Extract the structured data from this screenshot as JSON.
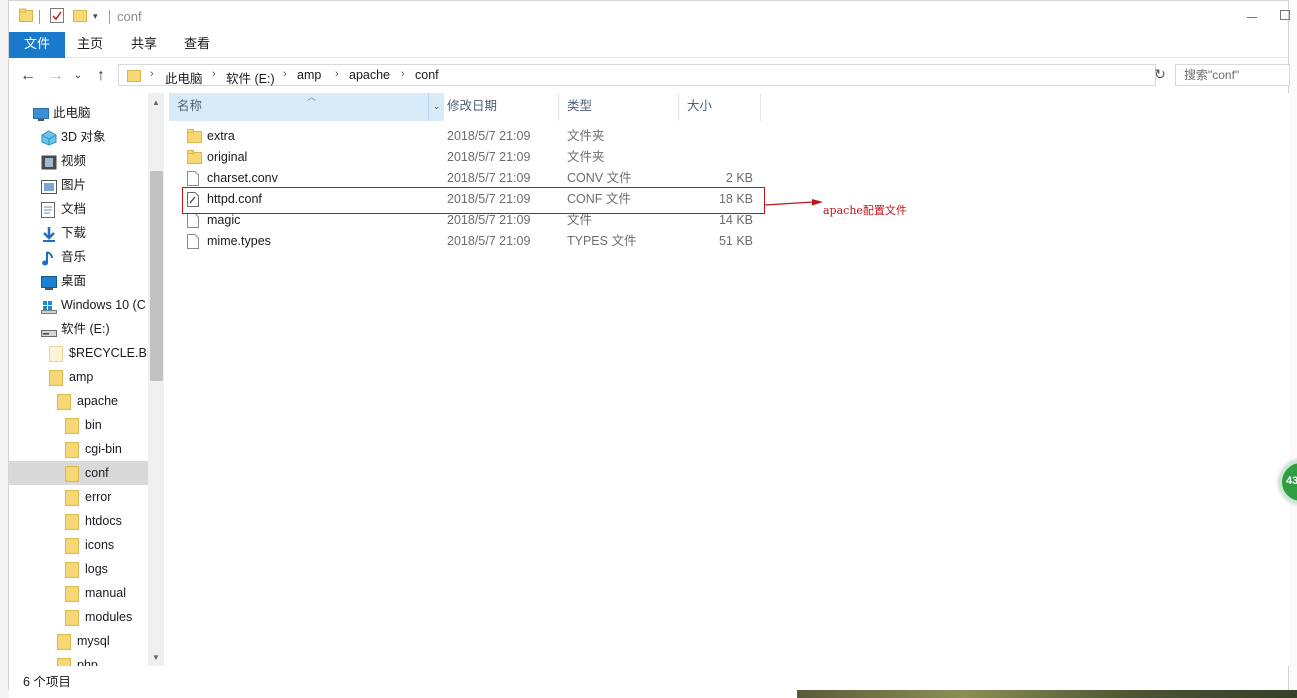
{
  "window": {
    "title": "conf"
  },
  "ribbon": {
    "tabs": [
      "文件",
      "主页",
      "共享",
      "查看"
    ]
  },
  "address": {
    "crumbs": [
      "此电脑",
      "软件 (E:)",
      "amp",
      "apache",
      "conf"
    ],
    "search_placeholder": "搜索\"conf\""
  },
  "nav": {
    "items": [
      {
        "label": "此电脑",
        "icon": "pc-icon"
      },
      {
        "label": "3D 对象",
        "icon": "3d-objects-icon"
      },
      {
        "label": "视频",
        "icon": "video-icon"
      },
      {
        "label": "图片",
        "icon": "pictures-icon"
      },
      {
        "label": "文档",
        "icon": "documents-icon"
      },
      {
        "label": "下载",
        "icon": "download-icon"
      },
      {
        "label": "音乐",
        "icon": "music-icon"
      },
      {
        "label": "桌面",
        "icon": "desktop-icon"
      },
      {
        "label": "Windows 10 (C",
        "icon": "windows-drive-icon"
      },
      {
        "label": "软件 (E:)",
        "icon": "drive-icon"
      },
      {
        "label": "$RECYCLE.BIN",
        "icon": "folder-icon"
      },
      {
        "label": "amp",
        "icon": "folder-icon"
      },
      {
        "label": "apache",
        "icon": "folder-icon"
      },
      {
        "label": "bin",
        "icon": "folder-icon"
      },
      {
        "label": "cgi-bin",
        "icon": "folder-icon"
      },
      {
        "label": "conf",
        "icon": "folder-icon",
        "selected": true
      },
      {
        "label": "error",
        "icon": "folder-icon"
      },
      {
        "label": "htdocs",
        "icon": "folder-icon"
      },
      {
        "label": "icons",
        "icon": "folder-icon"
      },
      {
        "label": "logs",
        "icon": "folder-icon"
      },
      {
        "label": "manual",
        "icon": "folder-icon"
      },
      {
        "label": "modules",
        "icon": "folder-icon"
      },
      {
        "label": "mysql",
        "icon": "folder-icon"
      },
      {
        "label": "php",
        "icon": "folder-icon"
      }
    ]
  },
  "columns": {
    "name": "名称",
    "date": "修改日期",
    "type": "类型",
    "size": "大小"
  },
  "files": [
    {
      "name": "extra",
      "date": "2018/5/7 21:09",
      "type": "文件夹",
      "size": "",
      "icon": "folder-icon"
    },
    {
      "name": "original",
      "date": "2018/5/7 21:09",
      "type": "文件夹",
      "size": "",
      "icon": "folder-icon"
    },
    {
      "name": "charset.conv",
      "date": "2018/5/7 21:09",
      "type": "CONV 文件",
      "size": "2 KB",
      "icon": "file-icon"
    },
    {
      "name": "httpd.conf",
      "date": "2018/5/7 21:09",
      "type": "CONF 文件",
      "size": "18 KB",
      "icon": "config-file-icon"
    },
    {
      "name": "magic",
      "date": "2018/5/7 21:09",
      "type": "文件",
      "size": "14 KB",
      "icon": "file-icon"
    },
    {
      "name": "mime.types",
      "date": "2018/5/7 21:09",
      "type": "TYPES 文件",
      "size": "51 KB",
      "icon": "file-icon"
    }
  ],
  "annotation": {
    "text": "apache配置文件",
    "color": "#c0131a"
  },
  "status": {
    "item_count": "6 个项目"
  },
  "badge": {
    "text": "43"
  },
  "colors": {
    "file_tab": "#1979ca",
    "selected_header": "#d9ebf9",
    "selection": "#d9d9d9",
    "folder": "#f8d775"
  }
}
